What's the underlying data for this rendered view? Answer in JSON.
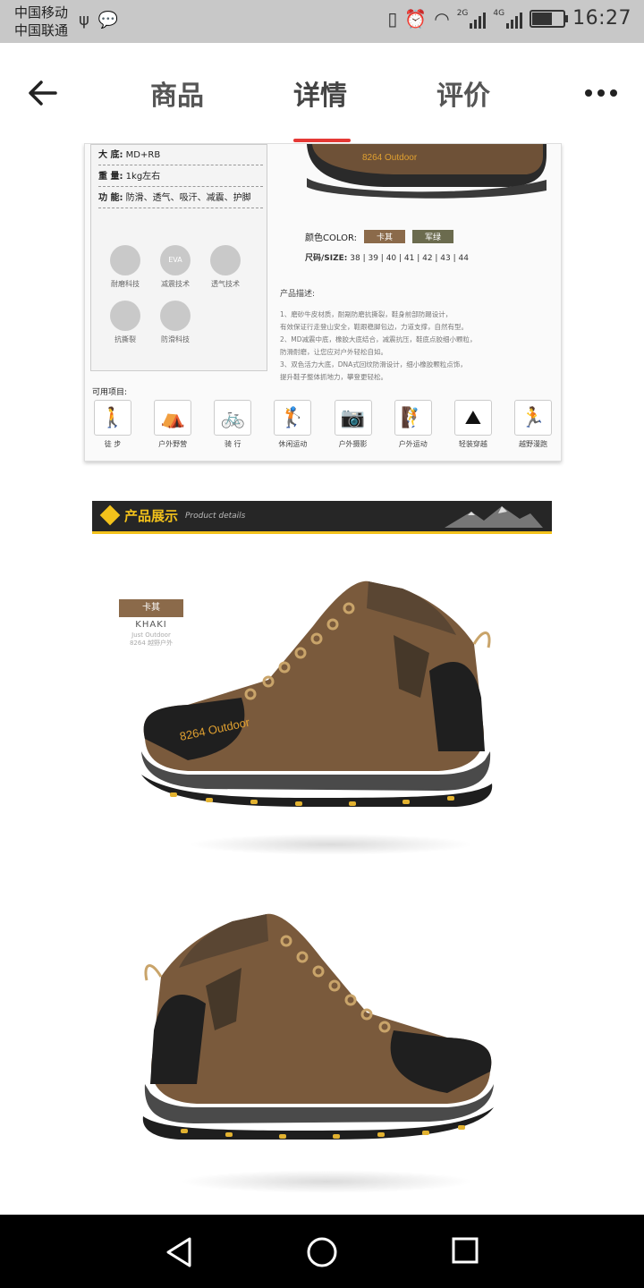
{
  "status_bar": {
    "carrier_1": "中国移动",
    "carrier_2": "中国联通",
    "network_1": "2G",
    "network_2": "4G",
    "time": "16:27"
  },
  "nav": {
    "tabs": [
      {
        "label": "商品",
        "active": false
      },
      {
        "label": "详情",
        "active": true
      },
      {
        "label": "评价",
        "active": false
      }
    ],
    "accent_color": "#e53935"
  },
  "spec": {
    "rows": [
      {
        "label": "大 底:",
        "value": "MD+RB"
      },
      {
        "label": "重 量:",
        "value": "1kg左右"
      },
      {
        "label": "功 能:",
        "value": "防滑、透气、吸汗、减震、护脚"
      }
    ],
    "features": [
      "耐磨科技",
      "减震技术",
      "透气技术",
      "抗撕裂",
      "防滑科技"
    ],
    "eva_text": "EVA",
    "shoe_logo": "8264 Outdoor",
    "color_label": "颜色COLOR:",
    "colors": [
      {
        "name": "卡其",
        "hex": "#8b6a4a"
      },
      {
        "name": "军绿",
        "hex": "#6b6b4e"
      }
    ],
    "size_label": "尺码/SIZE:",
    "sizes": "38 | 39 | 40 | 41 | 42 | 43 | 44",
    "desc_title": "产品描述:",
    "desc_lines": [
      "1、磨砂牛皮材质，耐剐防磨抗撕裂，鞋身前部防踢设计，",
      "有效保证行走登山安全，鞋跟稳脚包边，力道支撑，自然有型。",
      "2、MD减震中底，橡胶大底结合，减震抗压，鞋底点胶细小颗粒，",
      "防滑耐磨，让您应对户外轻松自如。",
      "3、双色活力大底，DNA式回纹防滑设计，细小橡胶颗粒点饰，",
      "提升鞋子整体抓地力，攀登更轻松。"
    ],
    "use_label": "可用项目:",
    "activities": [
      "徒 步",
      "户外野营",
      "骑 行",
      "休闲运动",
      "户外摄影",
      "户外运动",
      "轻装穿越",
      "越野漫跑"
    ]
  },
  "banner": {
    "title": "产品展示",
    "subtitle": "Product details"
  },
  "product": {
    "color_cn": "卡其",
    "color_en": "KHAKI",
    "small_1": "Just Outdoor",
    "small_2": "8264 越野户外"
  }
}
